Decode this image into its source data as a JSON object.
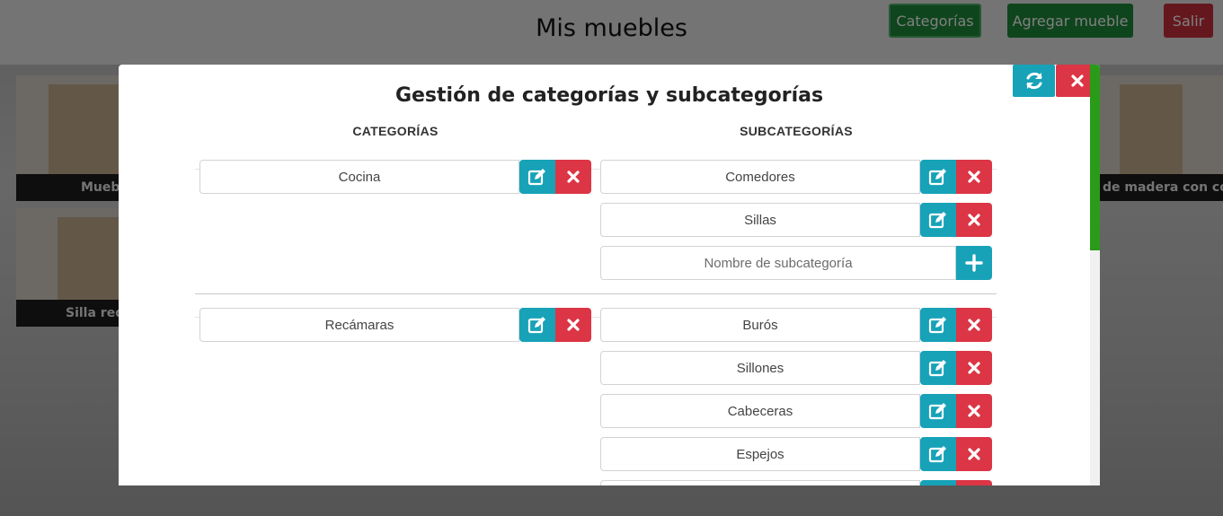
{
  "page": {
    "title": "Mis muebles",
    "nav": {
      "categories_label": "Categorías",
      "add_label": "Agregar mueble",
      "exit_label": "Salir"
    },
    "cards": [
      {
        "caption": "Mueb"
      },
      {
        "caption": "de madera con coj"
      },
      {
        "caption": "Silla red"
      }
    ]
  },
  "modal": {
    "title": "Gestión de categorías y subcategorías",
    "categories_header": "CATEGORÍAS",
    "subcategories_header": "SUBCATEGORÍAS",
    "new_subcategory_placeholder": "Nombre de subcategoría",
    "groups": [
      {
        "category": "Cocina",
        "subcategories": [
          "Comedores",
          "Sillas"
        ]
      },
      {
        "category": "Recámaras",
        "subcategories": [
          "Burós",
          "Sillones",
          "Cabeceras",
          "Espejos"
        ]
      }
    ]
  },
  "colors": {
    "edit": "#17a2b8",
    "delete": "#dc3545",
    "nav_green": "#1f8a3a",
    "scroll_thumb": "#2a9b19"
  },
  "icons": {
    "refresh": "refresh-icon",
    "close": "close-icon",
    "edit": "edit-icon",
    "delete": "x-icon",
    "add": "plus-icon"
  }
}
